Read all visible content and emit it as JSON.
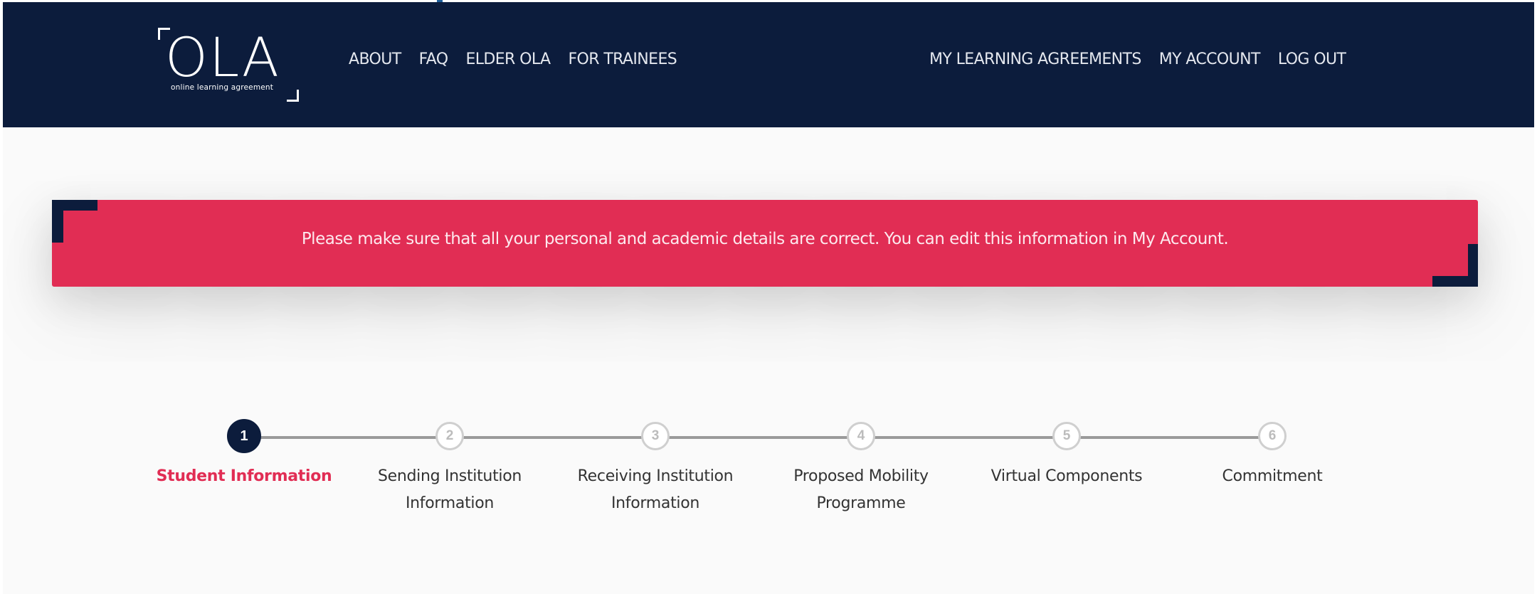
{
  "header": {
    "logo_word": "OLA",
    "logo_tagline": "online learning agreement",
    "nav_left": [
      {
        "label": "ABOUT"
      },
      {
        "label": "FAQ"
      },
      {
        "label": "ELDER OLA"
      },
      {
        "label": "FOR TRAINEES"
      }
    ],
    "nav_right": [
      {
        "label": "MY LEARNING AGREEMENTS"
      },
      {
        "label": "MY ACCOUNT"
      },
      {
        "label": "LOG OUT"
      }
    ]
  },
  "alert": {
    "message": "Please make sure that all your personal and academic details are correct. You can edit this information in My Account."
  },
  "stepper": {
    "active_step": 1,
    "steps": [
      {
        "number": "1",
        "label_line1": "Student Information",
        "label_line2": ""
      },
      {
        "number": "2",
        "label_line1": "Sending Institution",
        "label_line2": "Information"
      },
      {
        "number": "3",
        "label_line1": "Receiving Institution",
        "label_line2": "Information"
      },
      {
        "number": "4",
        "label_line1": "Proposed Mobility",
        "label_line2": "Programme"
      },
      {
        "number": "5",
        "label_line1": "Virtual Components",
        "label_line2": ""
      },
      {
        "number": "6",
        "label_line1": "Commitment",
        "label_line2": ""
      }
    ]
  },
  "colors": {
    "navy": "#0c1c3c",
    "accent_red": "#e12d54",
    "inactive_step": "#cfcfcf",
    "background": "#fafafa"
  }
}
